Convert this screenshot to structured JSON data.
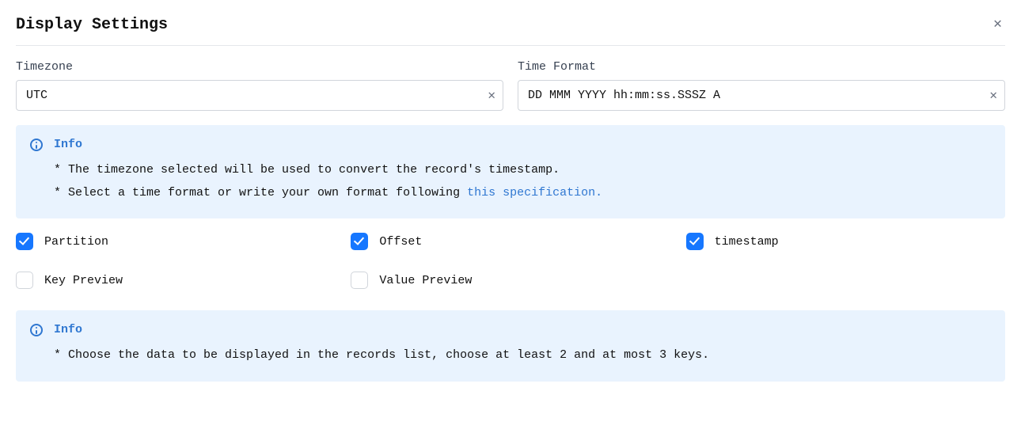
{
  "title": "Display Settings",
  "fields": {
    "timezone": {
      "label": "Timezone",
      "value": "UTC"
    },
    "timeformat": {
      "label": "Time Format",
      "value": "DD MMM YYYY hh:mm:ss.SSSZ A"
    }
  },
  "info1": {
    "title": "Info",
    "line1": "* The timezone selected will be used to convert the record's timestamp.",
    "line2_pre": "* Select a time format or write your own format following ",
    "line2_link": "this specification."
  },
  "checks": {
    "partition": {
      "label": "Partition",
      "checked": true
    },
    "offset": {
      "label": "Offset",
      "checked": true
    },
    "timestamp": {
      "label": "timestamp",
      "checked": true
    },
    "keypreview": {
      "label": "Key Preview",
      "checked": false
    },
    "valuepreview": {
      "label": "Value Preview",
      "checked": false
    }
  },
  "info2": {
    "title": "Info",
    "line1": "* Choose the data to be displayed in the records list, choose at least 2 and at most 3 keys."
  }
}
